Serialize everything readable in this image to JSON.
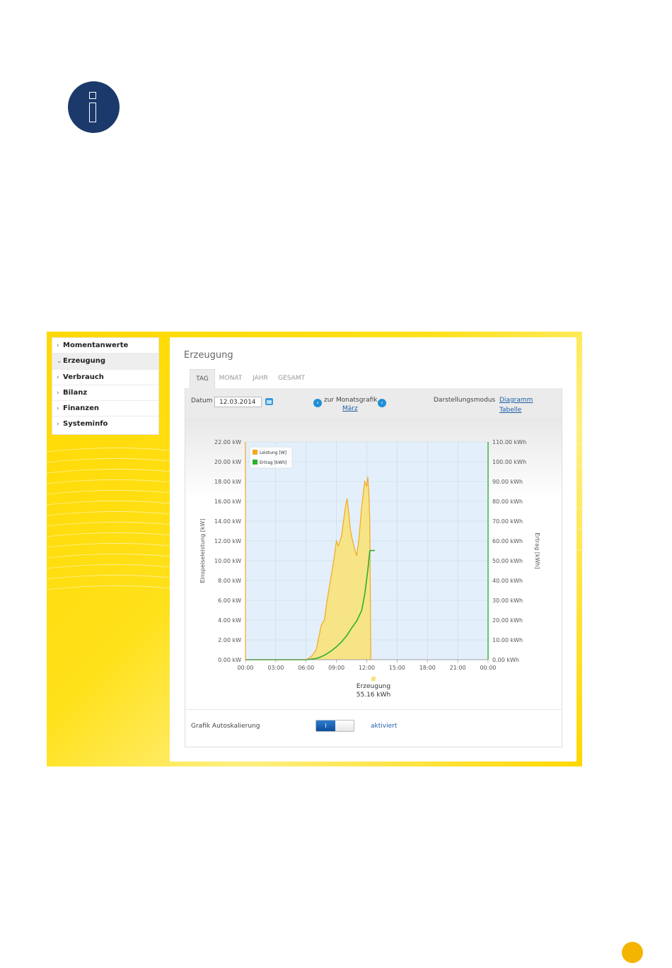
{
  "sidebar": {
    "items": [
      {
        "label": "Momentanwerte",
        "chevron": "›",
        "active": false
      },
      {
        "label": "Erzeugung",
        "chevron": "⌄",
        "active": true
      },
      {
        "label": "Verbrauch",
        "chevron": "›",
        "active": false
      },
      {
        "label": "Bilanz",
        "chevron": "›",
        "active": false
      },
      {
        "label": "Finanzen",
        "chevron": "›",
        "active": false
      },
      {
        "label": "Systeminfo",
        "chevron": "›",
        "active": false
      }
    ]
  },
  "main": {
    "title": "Erzeugung",
    "tabs": [
      "TAG",
      "MONAT",
      "JAHR",
      "GESAMT"
    ],
    "active_tab": "TAG"
  },
  "toolbar": {
    "date_label": "Datum",
    "date_value": "12.03.2014",
    "nav_text": "zur Monatsgrafik",
    "nav_link": "März",
    "prev_symbol": "‹",
    "next_symbol": "›",
    "mode_label": "Darstellungsmodus",
    "mode_diagram": "Diagramm",
    "mode_table": "Tabelle"
  },
  "chart_data": {
    "type": "area",
    "x": [
      "00:00",
      "03:00",
      "06:00",
      "09:00",
      "12:00",
      "15:00",
      "18:00",
      "21:00",
      "00:00"
    ],
    "ylabel": "Einspeiseleistung [kW]",
    "ylabel_right": "Ertrag [kWh]",
    "y_ticks": [
      "0.00 kW",
      "2.00 kW",
      "4.00 kW",
      "6.00 kW",
      "8.00 kW",
      "10.00 kW",
      "12.00 kW",
      "14.00 kW",
      "16.00 kW",
      "18.00 kW",
      "20.00 kW",
      "22.00 kW"
    ],
    "y2_ticks": [
      "0.00 kWh",
      "10.00 kWh",
      "20.00 kWh",
      "30.00 kWh",
      "40.00 kWh",
      "50.00 kWh",
      "60.00 kWh",
      "70.00 kWh",
      "80.00 kWh",
      "90.00 kWh",
      "100.00 kWh",
      "110.00 kWh"
    ],
    "ylim": [
      0,
      22
    ],
    "y2lim": [
      0,
      110
    ],
    "xlim_hours": [
      0,
      24
    ],
    "grid": true,
    "legend_position": "top-left",
    "series": [
      {
        "name": "Leistung [W]",
        "color": "#f5a623",
        "fill": "#f7e27a",
        "points": [
          [
            0,
            0
          ],
          [
            6.0,
            0
          ],
          [
            6.5,
            0.3
          ],
          [
            7.0,
            1.0
          ],
          [
            7.2,
            2.0
          ],
          [
            7.5,
            3.5
          ],
          [
            7.8,
            4.0
          ],
          [
            8.0,
            5.5
          ],
          [
            8.4,
            8.0
          ],
          [
            8.8,
            10.5
          ],
          [
            9.0,
            12.0
          ],
          [
            9.2,
            11.5
          ],
          [
            9.5,
            12.5
          ],
          [
            9.7,
            14.0
          ],
          [
            9.9,
            15.5
          ],
          [
            10.05,
            16.3
          ],
          [
            10.2,
            15.0
          ],
          [
            10.4,
            13.0
          ],
          [
            10.6,
            12.0
          ],
          [
            10.8,
            11.2
          ],
          [
            11.0,
            10.5
          ],
          [
            11.2,
            12.0
          ],
          [
            11.5,
            15.5
          ],
          [
            11.8,
            18.0
          ],
          [
            12.0,
            17.5
          ],
          [
            12.1,
            18.5
          ],
          [
            12.2,
            17.0
          ],
          [
            12.3,
            14.0
          ],
          [
            12.4,
            0
          ]
        ]
      },
      {
        "name": "Ertrag [kWh]",
        "color": "#2db02d",
        "points": [
          [
            0,
            0
          ],
          [
            6.0,
            0
          ],
          [
            7.0,
            0.6
          ],
          [
            7.5,
            1.5
          ],
          [
            8.0,
            2.8
          ],
          [
            8.5,
            4.5
          ],
          [
            9.0,
            6.5
          ],
          [
            9.5,
            9.0
          ],
          [
            10.0,
            12.0
          ],
          [
            10.5,
            16.0
          ],
          [
            11.0,
            19.5
          ],
          [
            11.5,
            25.0
          ],
          [
            11.8,
            33.0
          ],
          [
            12.1,
            45.0
          ],
          [
            12.3,
            55.0
          ],
          [
            12.4,
            55.16
          ],
          [
            12.8,
            55.16
          ]
        ]
      }
    ],
    "footer_label": "Erzeugung",
    "footer_value": "55.16 kWh"
  },
  "settings": {
    "autoscale_label": "Grafik Autoskalierung",
    "toggle_on_label": "I",
    "status": "aktiviert"
  },
  "colors": {
    "brand_yellow": "#ffd800",
    "link_blue": "#1f5fa8",
    "navy": "#1b3a6b",
    "page_marker": "#f4b400"
  }
}
